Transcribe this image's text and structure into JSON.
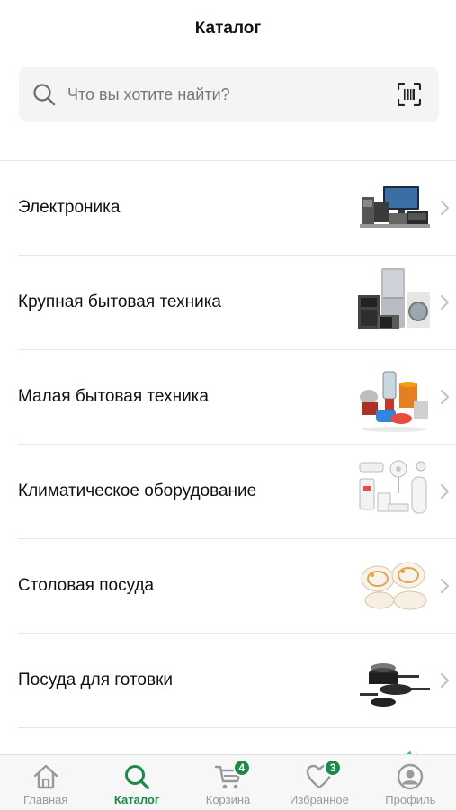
{
  "header": {
    "title": "Каталог"
  },
  "search": {
    "placeholder": "Что вы хотите найти?",
    "value": ""
  },
  "categories": [
    {
      "label": "Электроника"
    },
    {
      "label": "Крупная бытовая техника"
    },
    {
      "label": "Малая бытовая техника"
    },
    {
      "label": "Климатическое оборудование"
    },
    {
      "label": "Столовая посуда"
    },
    {
      "label": "Посуда для готовки"
    }
  ],
  "tabbar": {
    "home": {
      "label": "Главная",
      "icon": "home-icon"
    },
    "catalog": {
      "label": "Каталог",
      "icon": "search-icon"
    },
    "cart": {
      "label": "Корзина",
      "icon": "cart-icon",
      "badge": "4"
    },
    "favorites": {
      "label": "Избранное",
      "icon": "heart-icon",
      "badge": "3"
    },
    "profile": {
      "label": "Профиль",
      "icon": "user-icon"
    }
  },
  "colors": {
    "accent": "#1a8a4a",
    "inactive": "#9a9a9a",
    "search_bg": "#f4f4f4"
  }
}
